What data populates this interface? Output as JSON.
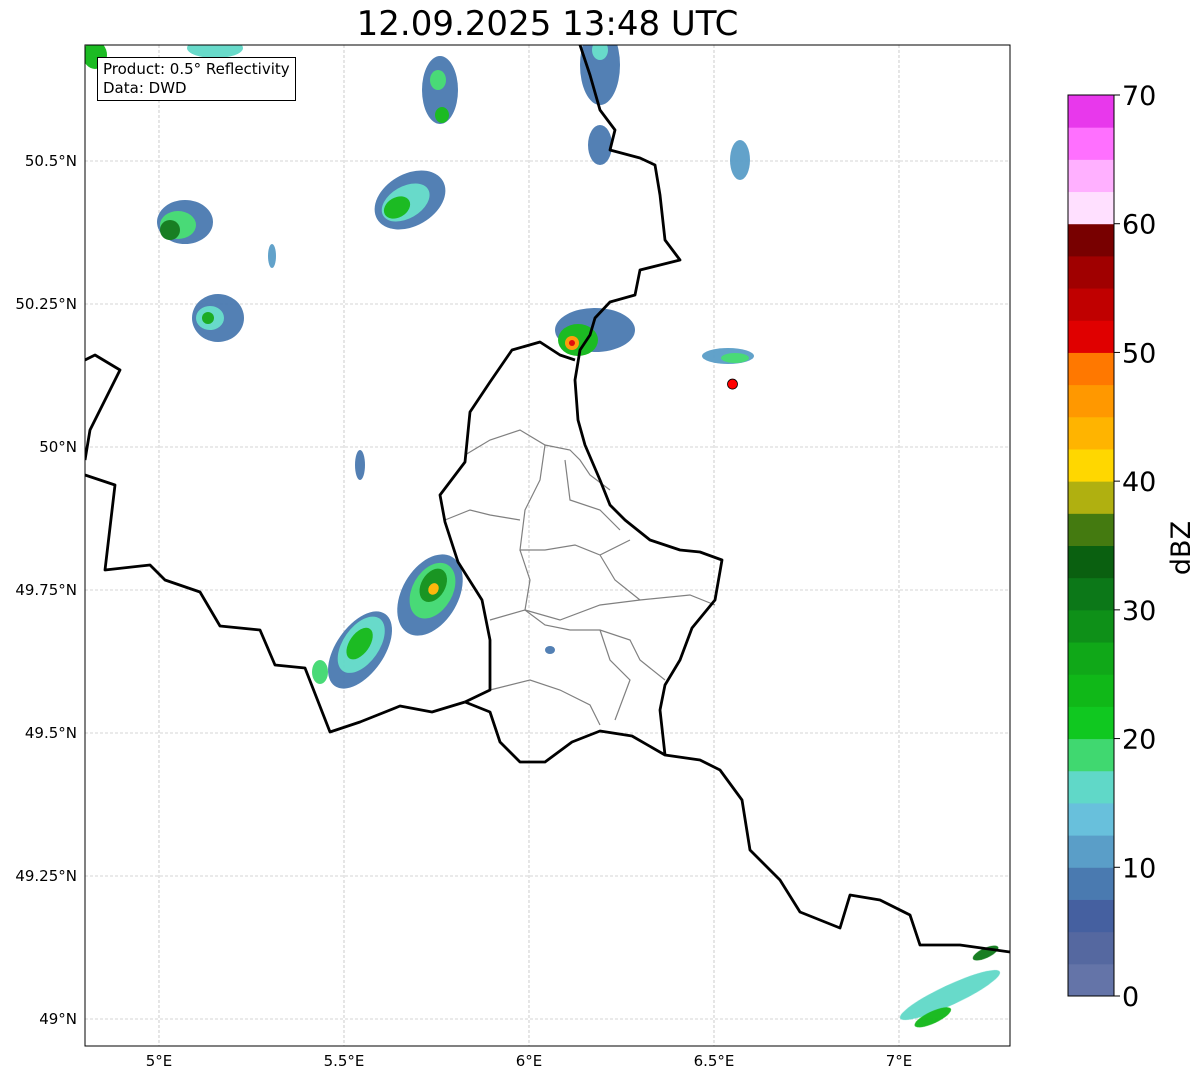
{
  "title": "12.09.2025 13:48 UTC",
  "info": {
    "product": "Product: 0.5° Reflectivity",
    "source": "Data: DWD"
  },
  "axes": {
    "lon_ticks": [
      {
        "value": 5,
        "label": "5°E"
      },
      {
        "value": 5.5,
        "label": "5.5°E"
      },
      {
        "value": 6,
        "label": "6°E"
      },
      {
        "value": 6.5,
        "label": "6.5°E"
      },
      {
        "value": 7,
        "label": "7°E"
      }
    ],
    "lat_ticks": [
      {
        "value": 50.5,
        "label": "50.5°N"
      },
      {
        "value": 50.25,
        "label": "50.25°N"
      },
      {
        "value": 50,
        "label": "50°N"
      },
      {
        "value": 49.75,
        "label": "49.75°N"
      },
      {
        "value": 49.5,
        "label": "49.5°N"
      },
      {
        "value": 49.25,
        "label": "49.25°N"
      },
      {
        "value": 49,
        "label": "49°N"
      }
    ],
    "lon_range": [
      4.8,
      7.3
    ],
    "lat_range": [
      48.95,
      50.7
    ]
  },
  "colorbar": {
    "label": "dBZ",
    "min": 0,
    "max": 70,
    "step": 2.5,
    "ticks": [
      "0",
      "10",
      "20",
      "30",
      "40",
      "50",
      "60",
      "70"
    ],
    "colors": [
      "#6474a8",
      "#5568a0",
      "#4560a0",
      "#4a7ab0",
      "#5a9ec8",
      "#68c0dc",
      "#60d8c8",
      "#40d870",
      "#10c820",
      "#10b818",
      "#10a818",
      "#0e9018",
      "#0c7818",
      "#0a6010",
      "#447a10",
      "#b0b010",
      "#ffd700",
      "#ffb400",
      "#ff9800",
      "#ff7800",
      "#e00000",
      "#c00000",
      "#a00000",
      "#780000",
      "#ffe0ff",
      "#ffb0ff",
      "#ff70ff",
      "#e838ec"
    ]
  },
  "radar_site": {
    "lon": 6.55,
    "lat": 50.11,
    "color": "#ff0000"
  }
}
